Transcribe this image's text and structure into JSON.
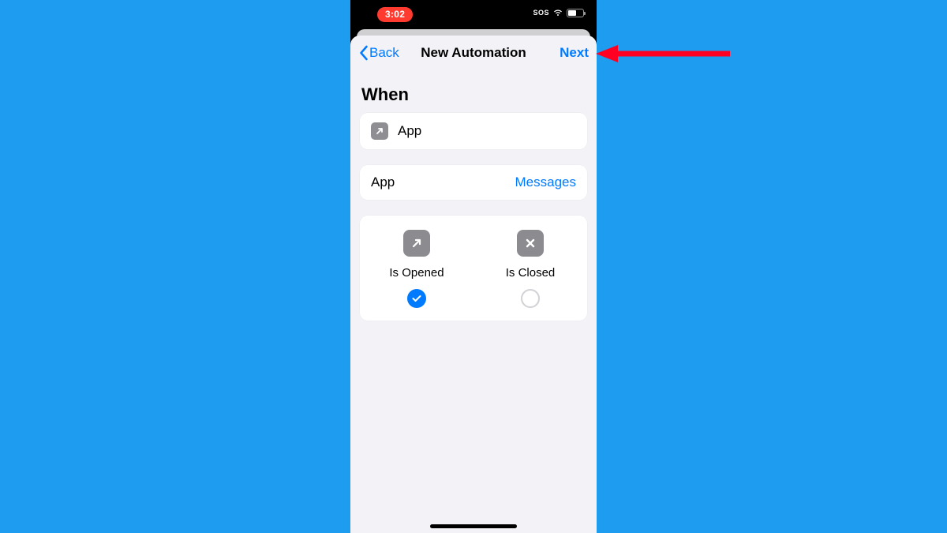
{
  "status": {
    "time": "3:02",
    "sos_label": "SOS"
  },
  "nav": {
    "back_label": "Back",
    "title": "New Automation",
    "next_label": "Next"
  },
  "section": {
    "when_heading": "When"
  },
  "trigger": {
    "type_label": "App",
    "picker_label": "App",
    "selected_app": "Messages"
  },
  "options": {
    "opened_label": "Is Opened",
    "closed_label": "Is Closed",
    "opened_selected": true,
    "closed_selected": false
  },
  "colors": {
    "ios_blue": "#007aff",
    "background_blue": "#1e9cf0",
    "sheet_bg": "#f2f2f7",
    "status_red": "#ff3b30",
    "arrow_red": "#ff0022"
  }
}
